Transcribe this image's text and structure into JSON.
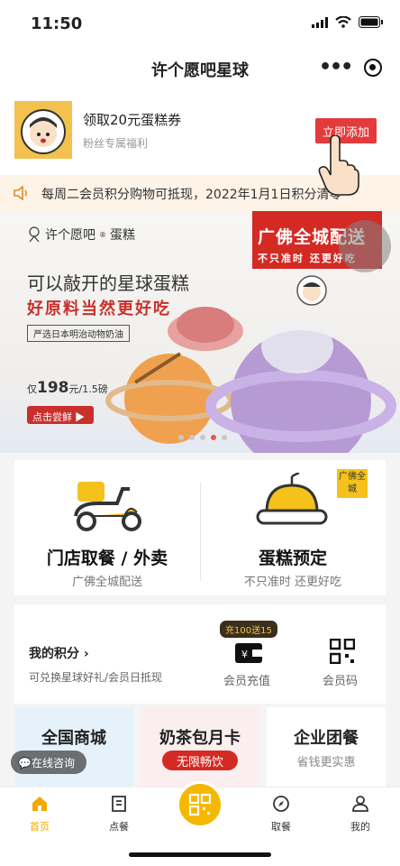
{
  "status": {
    "time": "11:50"
  },
  "nav": {
    "title": "许个愿吧星球"
  },
  "coupon": {
    "title": "领取20元蛋糕券",
    "subtitle": "粉丝专属福利",
    "button": "立即添加"
  },
  "notice": {
    "text": "每周二会员积分购物可抵现，2022年1月1日积分清零"
  },
  "banner": {
    "brand": "许个愿吧",
    "brand_sup": "®",
    "brand_suffix": "蛋糕",
    "headline": "可以敲开的星球蛋糕",
    "slogan": "好原料当然更好吃",
    "tag": "严选日本明治动物奶油",
    "price_prefix": "仅",
    "price": "198",
    "price_unit": "元/1.5磅",
    "buy": "点击尝鲜",
    "promo_line1": "广佛全城配送",
    "promo_line2": "不只准时 还更好吃",
    "dots": 5,
    "active_dot": 3
  },
  "services": [
    {
      "title": "门店取餐 / 外卖",
      "subtitle": "广佛全城配送",
      "icon": "scooter-icon"
    },
    {
      "title": "蛋糕预定",
      "subtitle": "不只准时 还更好吃",
      "icon": "cake-icon",
      "badge": "广佛全城"
    }
  ],
  "points": {
    "title": "我的积分",
    "arrow": "›",
    "subtitle": "可兑换星球好礼/会员日抵现",
    "badge": "充100送15",
    "recharge_label": "会员充值",
    "code_label": "会员码"
  },
  "promos": [
    {
      "title": "全国商城",
      "subtitle": ""
    },
    {
      "title": "奶茶包月卡",
      "pill": "无限畅饮"
    },
    {
      "title": "企业团餐",
      "subtitle": "省钱更实惠"
    }
  ],
  "consult": {
    "label": "在线咨询"
  },
  "tabs": [
    {
      "label": "首页",
      "icon": "home-icon"
    },
    {
      "label": "点餐",
      "icon": "menu-icon"
    },
    {
      "label": "取餐",
      "icon": "compass-icon"
    },
    {
      "label": "我的",
      "icon": "user-icon"
    }
  ],
  "colors": {
    "accent": "#f5b800",
    "brand_red": "#d42a24",
    "notice_bg": "#fdf3e6"
  }
}
